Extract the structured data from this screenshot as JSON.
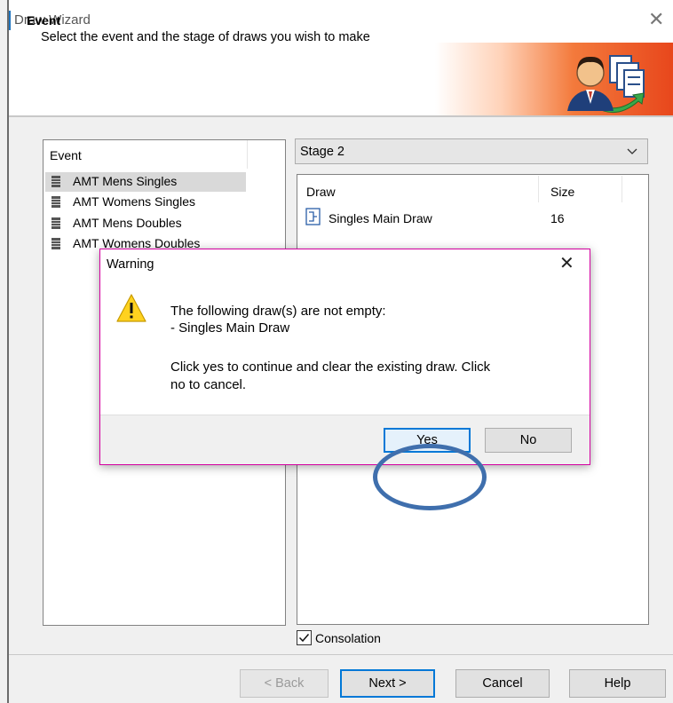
{
  "window": {
    "title": "Draw Wizard"
  },
  "header": {
    "title": "Event",
    "subtitle": "Select the event and the stage of draws you wish to make"
  },
  "event_list": {
    "header": "Event",
    "items": [
      {
        "label": "AMT Mens Singles",
        "selected": true
      },
      {
        "label": "AMT Womens Singles",
        "selected": false
      },
      {
        "label": "AMT Mens Doubles",
        "selected": false
      },
      {
        "label": "AMT Womens Doubles",
        "selected": false
      }
    ]
  },
  "stage_select": {
    "value": "Stage 2"
  },
  "draw_table": {
    "columns": [
      "Draw",
      "Size"
    ],
    "rows": [
      {
        "draw": "Singles Main Draw",
        "size": "16"
      }
    ]
  },
  "consolation": {
    "label": "Consolation",
    "checked": true
  },
  "buttons": {
    "back": "< Back",
    "next": "Next >",
    "cancel": "Cancel",
    "help": "Help"
  },
  "dialog": {
    "title": "Warning",
    "line1": "The following draw(s) are not empty:",
    "line2": "- Singles Main Draw",
    "line3": "Click yes to continue and clear the existing draw. Click",
    "line4": "no to cancel.",
    "yes": "Yes",
    "no": "No"
  },
  "colors": {
    "accent": "#0078d7",
    "dialog_border": "#d400a0",
    "annotation": "#3f6fad",
    "header_gradient_end": "#e8471c"
  },
  "icons": [
    "close-icon",
    "wizard-person-icon",
    "event-icon",
    "draw-icon",
    "chevron-down-icon",
    "checkbox-icon",
    "warning-icon"
  ]
}
